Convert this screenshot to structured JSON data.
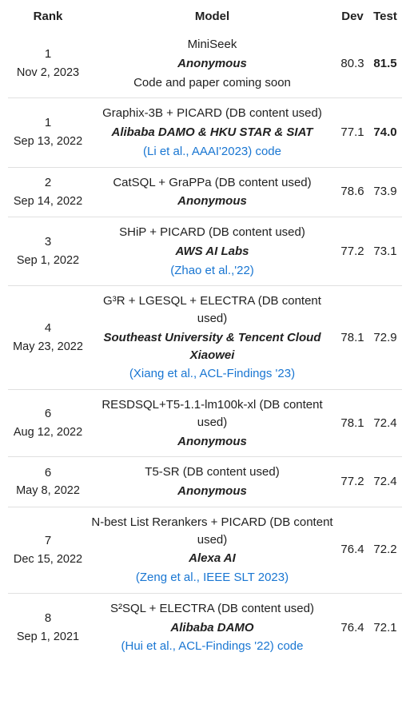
{
  "headers": {
    "rank": "Rank",
    "model": "Model",
    "dev": "Dev",
    "test": "Test"
  },
  "rows": [
    {
      "rank": "1",
      "date": "Nov 2, 2023",
      "model": "MiniSeek",
      "team": "Anonymous",
      "note": "Code and paper coming soon",
      "paper_link": "",
      "code_link": "",
      "dev": "80.3",
      "test": "81.5",
      "test_bold": true
    },
    {
      "rank": "1",
      "date": "Sep 13, 2022",
      "model": "Graphix-3B + PICARD (DB content used)",
      "team": "Alibaba DAMO & HKU STAR & SIAT",
      "note": "",
      "paper_link": "(Li et al., AAAI'2023)",
      "code_link": "code",
      "dev": "77.1",
      "test": "74.0",
      "test_bold": true
    },
    {
      "rank": "2",
      "date": "Sep 14, 2022",
      "model": "CatSQL + GraPPa (DB content used)",
      "team": "Anonymous",
      "note": "",
      "paper_link": "",
      "code_link": "",
      "dev": "78.6",
      "test": "73.9",
      "test_bold": false
    },
    {
      "rank": "3",
      "date": "Sep 1, 2022",
      "model": "SHiP + PICARD (DB content used)",
      "team": "AWS AI Labs",
      "note": "",
      "paper_link": "(Zhao et al.,'22)",
      "code_link": "",
      "dev": "77.2",
      "test": "73.1",
      "test_bold": false
    },
    {
      "rank": "4",
      "date": "May 23, 2022",
      "model": "G³R + LGESQL + ELECTRA (DB content used)",
      "team": "Southeast University & Tencent Cloud Xiaowei",
      "note": "",
      "paper_link": "(Xiang et al., ACL-Findings '23)",
      "code_link": "",
      "dev": "78.1",
      "test": "72.9",
      "test_bold": false
    },
    {
      "rank": "6",
      "date": "Aug 12, 2022",
      "model": "RESDSQL+T5-1.1-lm100k-xl (DB content used)",
      "team": "Anonymous",
      "note": "",
      "paper_link": "",
      "code_link": "",
      "dev": "78.1",
      "test": "72.4",
      "test_bold": false
    },
    {
      "rank": "6",
      "date": "May 8, 2022",
      "model": "T5-SR (DB content used)",
      "team": "Anonymous",
      "note": "",
      "paper_link": "",
      "code_link": "",
      "dev": "77.2",
      "test": "72.4",
      "test_bold": false
    },
    {
      "rank": "7",
      "date": "Dec 15, 2022",
      "model": "N-best List Rerankers + PICARD (DB content used)",
      "team": "Alexa AI",
      "note": "",
      "paper_link": "(Zeng et al., IEEE SLT 2023)",
      "code_link": "",
      "dev": "76.4",
      "test": "72.2",
      "test_bold": false
    },
    {
      "rank": "8",
      "date": "Sep 1, 2021",
      "model": "S²SQL + ELECTRA (DB content used)",
      "team": "Alibaba DAMO",
      "note": "",
      "paper_link": "(Hui et al., ACL-Findings '22)",
      "code_link": "code",
      "dev": "76.4",
      "test": "72.1",
      "test_bold": false
    }
  ]
}
